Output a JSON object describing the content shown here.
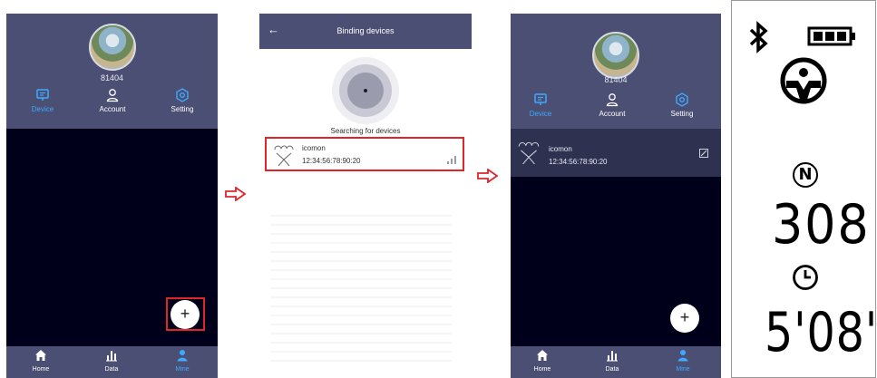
{
  "screen1": {
    "username": "81404",
    "tabs": [
      {
        "label": "Device",
        "icon": "device-icon",
        "active": true
      },
      {
        "label": "Account",
        "icon": "account-icon",
        "active": false
      },
      {
        "label": "Setting",
        "icon": "setting-icon",
        "active": false
      }
    ],
    "fab_label": "+",
    "bottom_nav": [
      {
        "label": "Home",
        "icon": "home-icon"
      },
      {
        "label": "Data",
        "icon": "data-chart-icon"
      },
      {
        "label": "Mine",
        "icon": "mine-person-icon"
      }
    ]
  },
  "screen2": {
    "title": "Binding devices",
    "back_icon": "back-arrow-icon",
    "searching_text": "Searching for devices",
    "device": {
      "name": "icomon",
      "mac": "12:34:56:78:90:20"
    }
  },
  "screen3": {
    "username": "81404",
    "tabs": [
      {
        "label": "Device",
        "icon": "device-icon",
        "active": true
      },
      {
        "label": "Account",
        "icon": "account-icon",
        "active": false
      },
      {
        "label": "Setting",
        "icon": "setting-icon",
        "active": false
      }
    ],
    "device": {
      "name": "icomon",
      "mac": "12:34:56:78:90:20"
    },
    "fab_label": "+",
    "bottom_nav": [
      {
        "label": "Home",
        "icon": "home-icon"
      },
      {
        "label": "Data",
        "icon": "data-chart-icon"
      },
      {
        "label": "Mine",
        "icon": "mine-person-icon"
      }
    ]
  },
  "display": {
    "icons": [
      "bluetooth-icon",
      "battery-icon",
      "person-icon",
      "clock-icon"
    ],
    "n_symbol": "N",
    "count_value": "308",
    "time_value": "5'08''"
  },
  "colors": {
    "header": "#4b4f73",
    "panel_bg": "#00001a",
    "accent": "#3fa9ff",
    "highlight": "#e0242a"
  }
}
